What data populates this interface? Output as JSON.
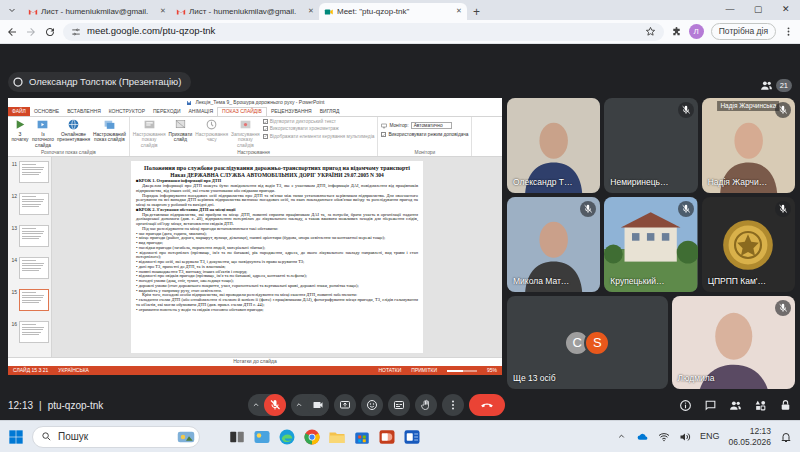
{
  "browser": {
    "tabs": [
      {
        "label": "Лист - humeniukmilav@gmail.",
        "selected": false
      },
      {
        "label": "Лист - humeniukmilav@gmail.",
        "selected": false
      },
      {
        "label": "Meet: \"ptu-qzop-tnk\"",
        "selected": true
      }
    ],
    "tab_close": "✕",
    "new_tab": "+",
    "window_controls": [
      "—",
      "▢",
      "✕"
    ],
    "url": "meet.google.com/ptu-qzop-tnk",
    "profile": "Л",
    "action": "Потрібна дія"
  },
  "meet": {
    "presenter": "Олександр Толстюк (Презентацію)",
    "people_count": "21",
    "time": "12:13",
    "separator": "|",
    "code": "ptu-qzop-tnk",
    "mic_muted": true
  },
  "ppt": {
    "title": "Лекція_Тема 9_ Брошура дорожнього руху - PowerPoint",
    "tabs": [
      {
        "label": "ФАЙЛ",
        "selected": false
      },
      {
        "label": "ОСНОВНЕ",
        "selected": false
      },
      {
        "label": "ВСТАВЛЕННЯ",
        "selected": false
      },
      {
        "label": "КОНСТРУКТОР",
        "selected": false
      },
      {
        "label": "ПЕРЕХОДИ",
        "selected": false
      },
      {
        "label": "АНІМАЦІЯ",
        "selected": false
      },
      {
        "label": "ПОКАЗ СЛАЙДІВ",
        "selected": true
      },
      {
        "label": "РЕЦЕНЗУВАННЯ",
        "selected": false
      },
      {
        "label": "ВИГЛЯД",
        "selected": false
      }
    ],
    "start_buttons": [
      "З початку",
      "Із поточного слайда",
      "Онлайнове презентування",
      "Настроюваний показ слайдів"
    ],
    "setup_buttons": [
      {
        "label": "Настроювання показу слайдів",
        "disabled": true
      },
      {
        "label": "Приховати слайд",
        "disabled": false
      },
      {
        "label": "Настроювання часу",
        "disabled": true
      },
      {
        "label": "Записування показу слайдів",
        "disabled": true
      }
    ],
    "checkboxes": [
      {
        "label": "Відтворити дикторський текст",
        "checked": true,
        "disabled": true
      },
      {
        "label": "Використовувати хронометраж",
        "checked": true,
        "disabled": true
      },
      {
        "label": "Відображати елементи керування мультимедіа",
        "checked": true,
        "disabled": true
      }
    ],
    "monitor_label": "Монітор:",
    "monitor_value": "Автоматично",
    "presenter_view": {
      "label": "Використовувати режим доповідача",
      "checked": true
    },
    "groups": [
      "Розпочати показ слайдів",
      "Настроювання",
      "Монітори"
    ],
    "thumbnails": [
      {
        "number": "11",
        "selected": false
      },
      {
        "number": "12",
        "selected": false
      },
      {
        "number": "13",
        "selected": false
      },
      {
        "number": "14",
        "selected": false
      },
      {
        "number": "15",
        "selected": true
      },
      {
        "number": "16",
        "selected": false
      }
    ],
    "slide": {
      "title": "Положення про службове розслідування дорожньо-транспортних пригод на відомчому транспорті",
      "subtitle": "Наказ ДЕРЖАВНА СЛУЖБА АВТОМОБІЛЬНИХ ДОРІГ УКРАЇНИ 29.07.2005 N 304",
      "paragraphs": [
        {
          "kind": "heading",
          "text": "■КРОК 1. Отримання інформації про ДТП"
        },
        {
          "kind": "text",
          "text": "Джерелом інформації про ДТП можуть бути: повідомлення від водія ТЗ, яке є учасником ДТП, інформація ДАІ, повідомлення від працівників підприємства, від інших осіб, які стали учасниками або свідками пригоди."
        },
        {
          "kind": "text",
          "text": "Порядок інформування посадових осіб підприємства про ДТП та зв'язки між ними установлюється керівником підприємства. Для своєчасного реагування на всі випадки ДТП керівник підприємства визначає посадових осіб, на яких покладаються обов'язки виїзду та розслідування пригод на місці за скаргою у робочий та вихідні дні."
        },
        {
          "kind": "heading",
          "text": "■КРОК 2. З'ясування обставин ДТП на місці події"
        },
        {
          "kind": "text",
          "text": "Представники підприємства, які прибули на місце ДТП, повинні сприяти працівникам ДАІ та, за потреби, брати участь в організації надання долікарської допомоги (див. с. 40), відправленню потерпілих до лікувального закладу, а також вживати можливих заходів для збереження слідів, організації об'їзду місця, встановлення свідків ДТП."
        },
        {
          "kind": "text",
          "text": "Під час розслідування на місці пригоди встановлюються такі обставини:"
        },
        {
          "kind": "bullet",
          "text": "• час пригоди (дата, година, хвилина);"
        },
        {
          "kind": "bullet",
          "text": "• місце пригоди (район, дорога, маршрут, вулиця, дільниця), наявні орієнтири (будова, опора освітлення чи контактної мережі тощо);"
        },
        {
          "kind": "bullet",
          "text": "• вид пригоди;"
        },
        {
          "kind": "bullet",
          "text": "• наслідки пригоди (загибель, поранення людей, матеріальні збитки);"
        },
        {
          "kind": "bullet",
          "text": "• відомості про потерпілих (прізвище, ім'я та по батькові, рік народження, адреса, до якого лікувального закладу направлені, вид травм і стан потерпілого);"
        },
        {
          "kind": "bullet",
          "text": "• відомості про осіб, які керували ТЗ, і документи, що засвідчують їх право керування ТЗ;"
        },
        {
          "kind": "bullet",
          "text": "• дані про ТЗ, причетні до ДТП, та їх власників;"
        },
        {
          "kind": "bullet",
          "text": "• наявні пошкодження ТЗ, вантажу, інших об'єктів і споруд;"
        },
        {
          "kind": "bullet",
          "text": "• відомості про свідків пригоди (прізвище, ім'я та по батькові, адреса, контактні телефони);"
        },
        {
          "kind": "bullet",
          "text": "• погодні умови (дощ, сніг, туман, ожеледиця тощо);"
        },
        {
          "kind": "bullet",
          "text": "• дорожні умови (стан дорожнього покриття, ухил, горизонтальні та вертикальні криві, дорожні знаки, розмітка тощо);"
        },
        {
          "kind": "bullet",
          "text": "• видимість у напрямку руху, стан освітлення."
        },
        {
          "kind": "text",
          "text": "Крім того, посадові особи підприємства, які проводили розслідування на місці скоєння ДТП, повинні забезпечити:"
        },
        {
          "kind": "bullet",
          "text": "• складання схеми ДТП (або ознайомлення зі схемою й копією її (фото) з працівниками ДАІ), фотографування місця пригоди, ТЗ, слідів гальмування та об'єктів, які могли обумовити ДТП (див. прикл. схеми ДТП с. 44);"
        },
        {
          "kind": "bullet",
          "text": "• отримання пояснень у водія та свідків стосовно обставин пригоди;"
        }
      ]
    },
    "notes": "Нотатки до слайда",
    "status": {
      "slide": "СЛАЙД 15 З 21",
      "language": "УКРАЇНСЬКА",
      "notes": "НОТАТКИ",
      "comments": "ПРИМІТКИ",
      "zoom": "95%",
      "zoom_level": 0.55
    }
  },
  "tiles": [
    {
      "name": "Олександр Т…",
      "kind": "video",
      "muted": false
    },
    {
      "name": "Немиринець…",
      "kind": "camera_off",
      "muted": true
    },
    {
      "name": "Надія Жарчи…",
      "kind": "video",
      "muted": true,
      "caption": "Надія Жарчинська"
    },
    {
      "name": "Микола Мат…",
      "kind": "video",
      "muted": true
    },
    {
      "name": "Крупецький…",
      "kind": "photo",
      "muted": true
    },
    {
      "name": "ЦПРПП Кам'…",
      "kind": "logo",
      "muted": true
    }
  ],
  "more": {
    "label": "Ще 13 осіб",
    "avatars": [
      {
        "letter": "C",
        "color": "#9e9e9e"
      },
      {
        "letter": "S",
        "color": "#e8581c"
      }
    ]
  },
  "self": {
    "name": "Людмила",
    "kind": "video",
    "muted": true
  },
  "taskbar": {
    "search": "Пошук",
    "language": "ENG",
    "time": "12:13",
    "date": "06.05.2026"
  }
}
